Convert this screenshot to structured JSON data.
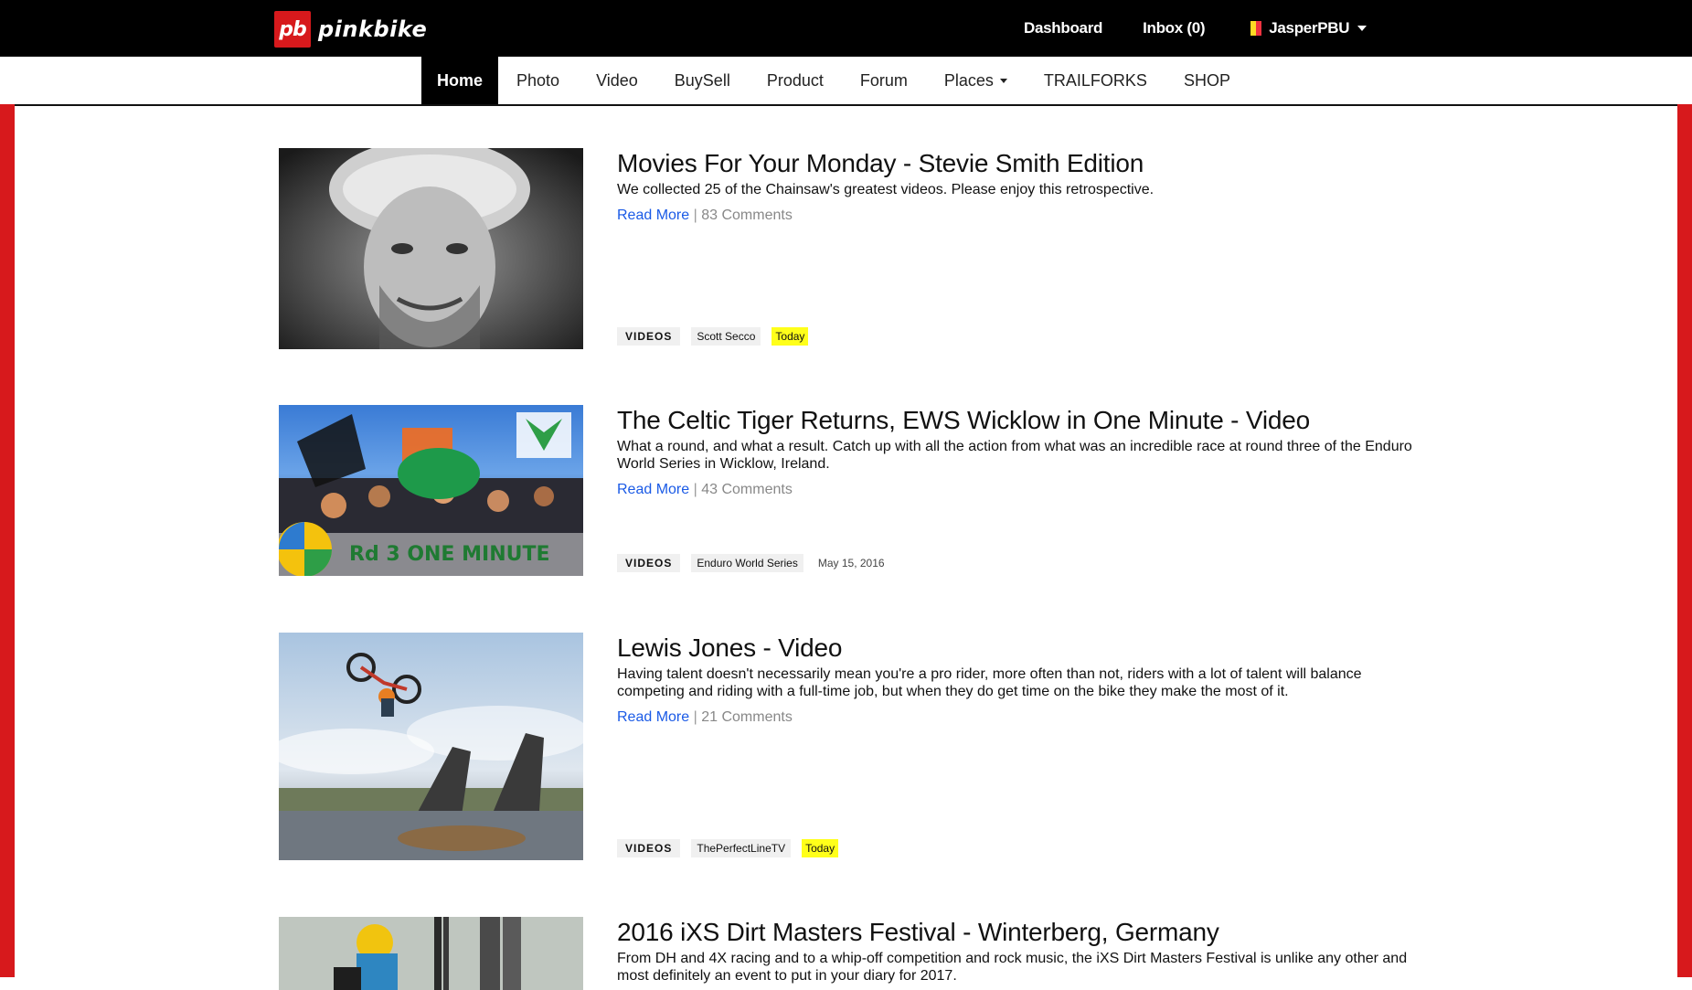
{
  "header": {
    "logo_badge": "pb",
    "logo_word": "pinkbike",
    "dashboard_label": "Dashboard",
    "inbox_label": "Inbox (0)",
    "username": "JasperPBU",
    "flag_colors": [
      "#000000",
      "#fdda24",
      "#ef3340"
    ]
  },
  "nav": {
    "items": [
      {
        "label": "Home",
        "active": true
      },
      {
        "label": "Photo"
      },
      {
        "label": "Video"
      },
      {
        "label": "BuySell"
      },
      {
        "label": "Product"
      },
      {
        "label": "Forum"
      },
      {
        "label": "Places",
        "dropdown": true
      },
      {
        "label": "TRAILFORKS"
      },
      {
        "label": "SHOP"
      }
    ]
  },
  "colors": {
    "brand_red": "#d7191c",
    "link_blue": "#1a5ae6",
    "today_highlight": "#ffff1a"
  },
  "articles": [
    {
      "title": "Movies For Your Monday - Stevie Smith Edition",
      "description": "We collected 25 of the Chainsaw's greatest videos. Please enjoy this retrospective.",
      "read_more": "Read More",
      "separator": "|",
      "comments": "83 Comments",
      "category": "VIDEOS",
      "author": "Scott Secco",
      "date": "Today",
      "date_highlight": true
    },
    {
      "title": "The Celtic Tiger Returns, EWS Wicklow in One Minute - Video",
      "description": "What a round, and what a result. Catch up with all the action from what was an incredible race at round three of the Enduro World Series in Wicklow, Ireland.",
      "read_more": "Read More",
      "separator": "|",
      "comments": "43 Comments",
      "category": "VIDEOS",
      "author": "Enduro World Series",
      "date": "May 15, 2016",
      "date_highlight": false,
      "thumb_caption": "Rd 3 ONE MINUTE"
    },
    {
      "title": "Lewis Jones - Video",
      "description": "Having talent doesn't necessarily mean you're a pro rider, more often than not, riders with a lot of talent will balance competing and riding with a full-time job, but when they do get time on the bike they make the most of it.",
      "read_more": "Read More",
      "separator": "|",
      "comments": "21 Comments",
      "category": "VIDEOS",
      "author": "ThePerfectLineTV",
      "date": "Today",
      "date_highlight": true
    },
    {
      "title": "2016 iXS Dirt Masters Festival - Winterberg, Germany",
      "description": "From DH and 4X racing and to a whip-off competition and rock music, the iXS Dirt Masters Festival is unlike any other and most definitely an event to put in your diary for 2017."
    }
  ]
}
